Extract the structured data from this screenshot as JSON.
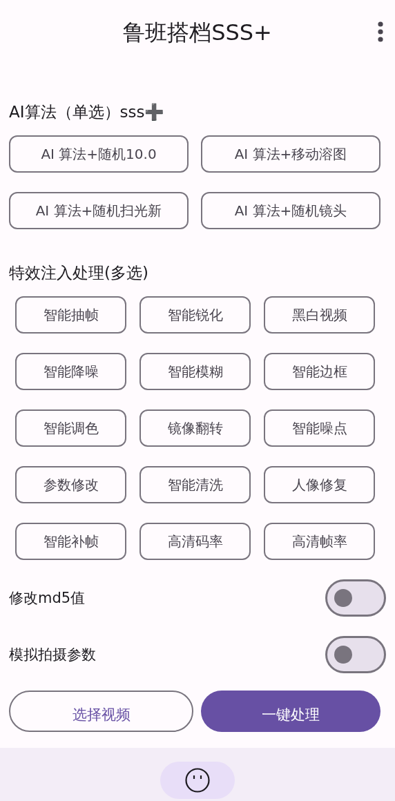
{
  "app_bar": {
    "title": "鲁班搭档SSS+"
  },
  "algorithm_section": {
    "title": "AI算法（单选）sss➕",
    "options": [
      {
        "label": "AI 算法+随机10.0",
        "selected": false
      },
      {
        "label": "AI 算法+移动溶图",
        "selected": false
      },
      {
        "label": "AI 算法+随机扫光新",
        "selected": false
      },
      {
        "label": "AI 算法+随机镜头",
        "selected": false
      }
    ]
  },
  "effects_section": {
    "title": "特效注入处理(多选)",
    "options": [
      {
        "label": "智能抽帧",
        "selected": false
      },
      {
        "label": "智能锐化",
        "selected": false
      },
      {
        "label": "黑白视频",
        "selected": false
      },
      {
        "label": "智能降噪",
        "selected": false
      },
      {
        "label": "智能模糊",
        "selected": false
      },
      {
        "label": "智能边框",
        "selected": false
      },
      {
        "label": "智能调色",
        "selected": false
      },
      {
        "label": "镜像翻转",
        "selected": false
      },
      {
        "label": "智能噪点",
        "selected": false
      },
      {
        "label": "参数修改",
        "selected": false
      },
      {
        "label": "智能清洗",
        "selected": false
      },
      {
        "label": "人像修复",
        "selected": false
      },
      {
        "label": "智能补帧",
        "selected": false
      },
      {
        "label": "高清码率",
        "selected": false
      },
      {
        "label": "高清帧率",
        "selected": false
      }
    ]
  },
  "switches": [
    {
      "label": "修改md5值",
      "on": false
    },
    {
      "label": "模拟拍摄参数",
      "on": false
    }
  ],
  "actions": [
    {
      "label": "选择视频",
      "kind": "outlined"
    },
    {
      "label": "一键处理",
      "kind": "filled"
    }
  ],
  "bottom_nav": {
    "items": [
      {
        "selected": true
      }
    ]
  }
}
